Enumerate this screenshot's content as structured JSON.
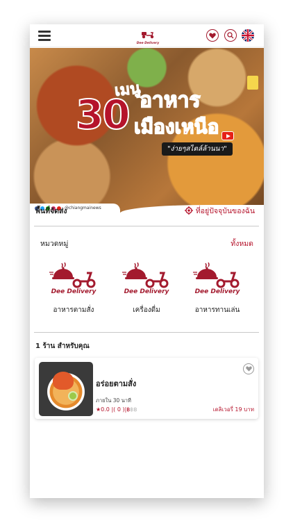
{
  "header": {
    "logo_text": "Dee Delivery",
    "language_flag": "uk-flag-icon",
    "icons": [
      "menu-icon",
      "heart-icon",
      "search-icon"
    ]
  },
  "banner": {
    "line1": "เมนู",
    "number": "30",
    "line2": "อาหาร",
    "line3": "เมืองเหนือ",
    "slogan": "\"ง่ายๆสไตล์ล้านนา\"",
    "social_handle": "@chiangmainews"
  },
  "delivery": {
    "label": "พื้นที่จัดส่ง",
    "location_label": "ที่อยู่ปัจจุบันของฉัน"
  },
  "categories": {
    "label": "หมวดหมู่",
    "all_label": "ทั้งหมด",
    "items": [
      {
        "brand": "Dee Delivery",
        "label": "อาหารตามสั่ง"
      },
      {
        "brand": "Dee Delivery",
        "label": "เครื่องดื่ม"
      },
      {
        "brand": "Dee Delivery",
        "label": "อาหารทานเล่น"
      }
    ]
  },
  "shops": {
    "count_label": "1 ร้าน สำหรับคุณ",
    "items": [
      {
        "name": "อร่อยตามสั่ง",
        "time": "ภายใน 30 นาที",
        "rating": "0.0",
        "reviews": "( 0 )",
        "price_symbol": "฿",
        "price_muted": "฿฿",
        "fee": "เดลิเวอรี่ 19 บาท"
      }
    ]
  },
  "colors": {
    "accent": "#b5132b",
    "brand_dark": "#a31a2e"
  }
}
